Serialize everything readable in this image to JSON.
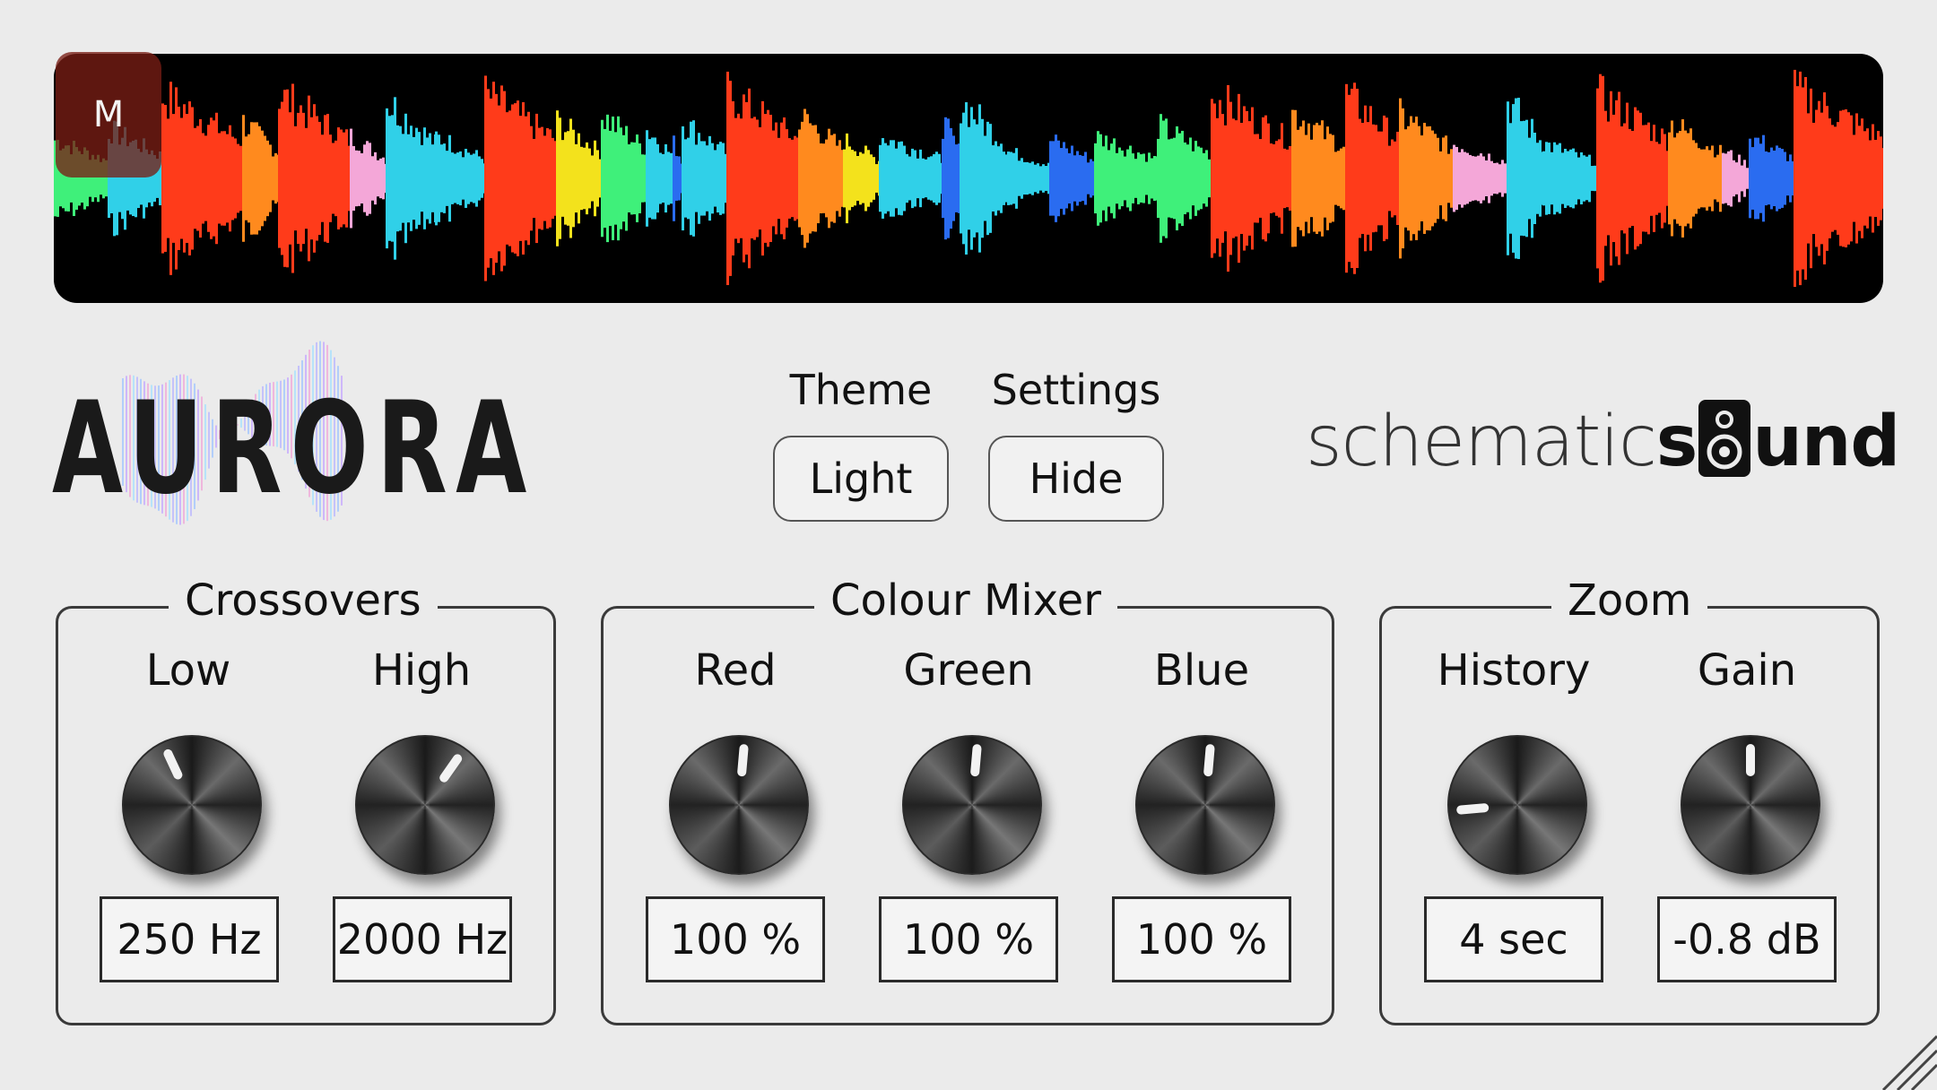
{
  "waveform": {
    "marker_label": "M",
    "colors": {
      "red": "#ff3b1a",
      "orange": "#ff8a1e",
      "yellow": "#f3e21c",
      "green": "#3ff07a",
      "cyan": "#30d0e8",
      "blue": "#2a6cf0",
      "pink": "#f4a7d8"
    }
  },
  "logo": {
    "text": "AURORA"
  },
  "theme": {
    "label": "Theme",
    "value": "Light"
  },
  "settings": {
    "label": "Settings",
    "value": "Hide"
  },
  "brand": {
    "part1": "schematic",
    "part2_start": "s",
    "part2_end": "und",
    "icon": "speaker-icon"
  },
  "groups": {
    "crossovers": {
      "title": "Crossovers",
      "knobs": [
        {
          "label": "Low",
          "value": "250 Hz",
          "angle": -25
        },
        {
          "label": "High",
          "value": "2000 Hz",
          "angle": 35
        }
      ]
    },
    "colour_mixer": {
      "title": "Colour Mixer",
      "knobs": [
        {
          "label": "Red",
          "value": "100 %",
          "angle": 5
        },
        {
          "label": "Green",
          "value": "100 %",
          "angle": 5
        },
        {
          "label": "Blue",
          "value": "100 %",
          "angle": 5
        }
      ]
    },
    "zoom": {
      "title": "Zoom",
      "knobs": [
        {
          "label": "History",
          "value": "4 sec",
          "angle": -95
        },
        {
          "label": "Gain",
          "value": "-0.8 dB",
          "angle": 0
        }
      ]
    }
  },
  "accent": "#1a1a1a"
}
